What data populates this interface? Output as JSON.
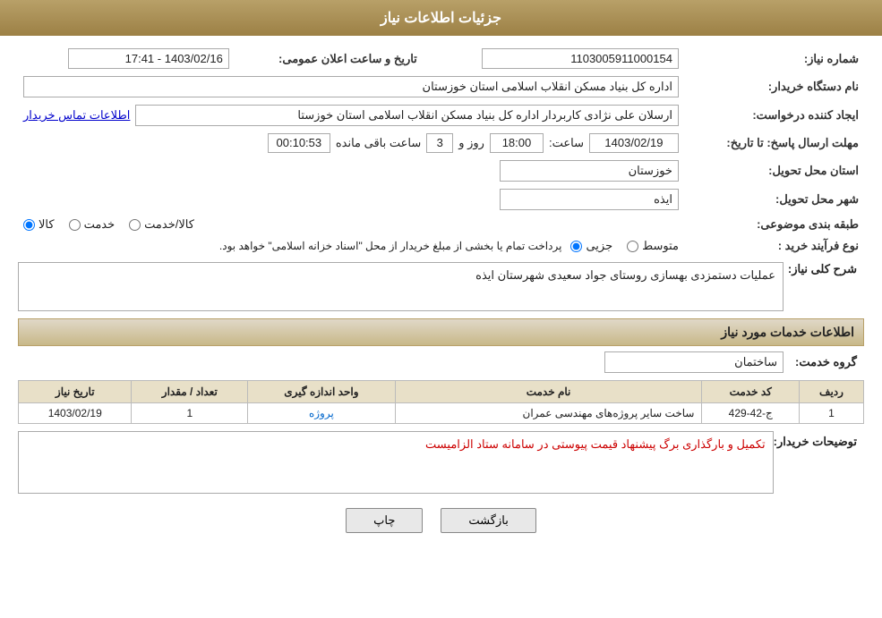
{
  "header": {
    "title": "جزئیات اطلاعات نیاز"
  },
  "fields": {
    "need_number_label": "شماره نیاز:",
    "need_number_value": "1103005911000154",
    "announce_date_label": "تاریخ و ساعت اعلان عمومی:",
    "announce_date_value": "1403/02/16 - 17:41",
    "buyer_name_label": "نام دستگاه خریدار:",
    "buyer_name_value": "اداره کل بنیاد مسکن انقلاب اسلامی استان خوزستان",
    "creator_label": "ایجاد کننده درخواست:",
    "creator_value": "ارسلان علی نژادی کاربردار اداره کل بنیاد مسکن انقلاب اسلامی استان خوزستا",
    "creator_link": "اطلاعات تماس خریدار",
    "send_deadline_label": "مهلت ارسال پاسخ: تا تاریخ:",
    "send_date_value": "1403/02/19",
    "send_time_label": "ساعت:",
    "send_time_value": "18:00",
    "send_days_label": "روز و",
    "send_days_value": "3",
    "remaining_label": "ساعت باقی مانده",
    "remaining_value": "00:10:53",
    "province_label": "استان محل تحویل:",
    "province_value": "خوزستان",
    "city_label": "شهر محل تحویل:",
    "city_value": "ایذه",
    "category_label": "طبقه بندی موضوعی:",
    "category_options": [
      "کالا",
      "خدمت",
      "کالا/خدمت"
    ],
    "category_selected": "کالا",
    "process_label": "نوع فرآیند خرید :",
    "process_options": [
      "جزیی",
      "متوسط"
    ],
    "process_note": "پرداخت تمام یا بخشی از مبلغ خریدار از محل \"اسناد خزانه اسلامی\" خواهد بود.",
    "need_desc_label": "شرح کلی نیاز:",
    "need_desc_value": "عملیات دستمزدی بهسازی روستای جواد سعیدی شهرستان ایذه"
  },
  "services_section": {
    "title": "اطلاعات خدمات مورد نیاز",
    "group_label": "گروه خدمت:",
    "group_value": "ساختمان",
    "table": {
      "headers": [
        "ردیف",
        "کد خدمت",
        "نام خدمت",
        "واحد اندازه گیری",
        "تعداد / مقدار",
        "تاریخ نیاز"
      ],
      "rows": [
        {
          "row": "1",
          "code": "ج-42-429",
          "name": "ساخت سایر پروژه‌های مهندسی عمران",
          "unit": "پروژه",
          "quantity": "1",
          "date": "1403/02/19"
        }
      ]
    }
  },
  "buyer_desc": {
    "label": "توضیحات خریدار:",
    "value": "تکمیل و بارگذاری برگ پیشنهاد قیمت پیوستی در سامانه ستاد الزامیست"
  },
  "buttons": {
    "print": "چاپ",
    "back": "بازگشت"
  }
}
